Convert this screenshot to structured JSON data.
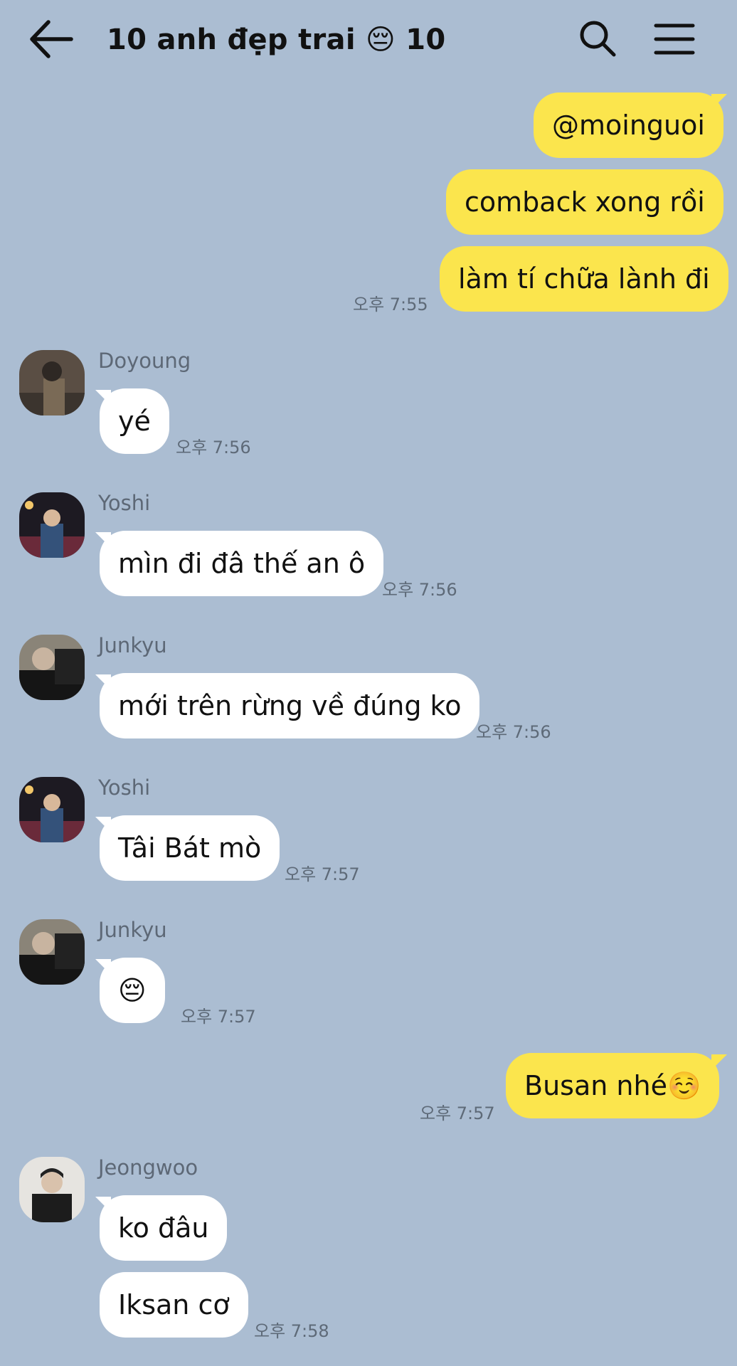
{
  "header": {
    "title": "10 anh đẹp trai 😔 10"
  },
  "messages": {
    "m1": {
      "text": "@moinguoi"
    },
    "m2": {
      "text": "comback xong rồi"
    },
    "m3": {
      "text": "làm tí chữa lành đi",
      "time": "오후 7:55"
    },
    "m4": {
      "sender": "Doyoung",
      "text": "yé",
      "time": "오후 7:56"
    },
    "m5": {
      "sender": "Yoshi",
      "text": "mìn đi đâ thế an ô",
      "time": "오후 7:56"
    },
    "m6": {
      "sender": "Junkyu",
      "text": "mới trên rừng về đúng ko",
      "time": "오후 7:56"
    },
    "m7": {
      "sender": "Yoshi",
      "text": "Tâi Bát mò",
      "time": "오후 7:57"
    },
    "m8": {
      "sender": "Junkyu",
      "text": "😔",
      "time": "오후 7:57"
    },
    "m9": {
      "text": "Busan nhé☺️",
      "time": "오후 7:57"
    },
    "m10": {
      "sender": "Jeongwoo",
      "text": "ko đâu"
    },
    "m11": {
      "text": "Iksan cơ",
      "time": "오후 7:58"
    }
  },
  "colors": {
    "background": "#abbdd2",
    "outgoing_bubble": "#fbe54d",
    "incoming_bubble": "#ffffff"
  },
  "icons": {
    "back": "arrow-left-icon",
    "search": "search-icon",
    "menu": "hamburger-menu-icon"
  }
}
